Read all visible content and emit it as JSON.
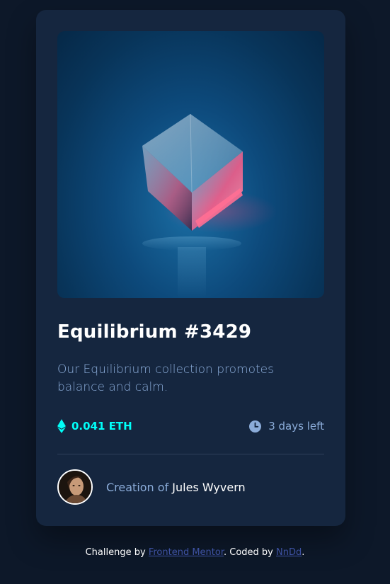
{
  "card": {
    "title": "Equilibrium #3429",
    "description": "Our Equilibrium collection promotes balance and calm.",
    "price": "0.041 ETH",
    "time_left": "3 days left",
    "creator_prefix": "Creation of",
    "creator_name": "Jules Wyvern"
  },
  "icons": {
    "price_icon": "ethereum-icon",
    "time_icon": "clock-icon"
  },
  "footer": {
    "prefix": "Challenge by",
    "link1": "Frontend Mentor",
    "middle": ". Coded by",
    "link2": "NnDd",
    "suffix": "."
  },
  "colors": {
    "background": "#0d1829",
    "card": "#15263f",
    "accent_cyan": "#00fff8",
    "soft_blue": "#8bacd9",
    "link": "#3e52a3"
  }
}
